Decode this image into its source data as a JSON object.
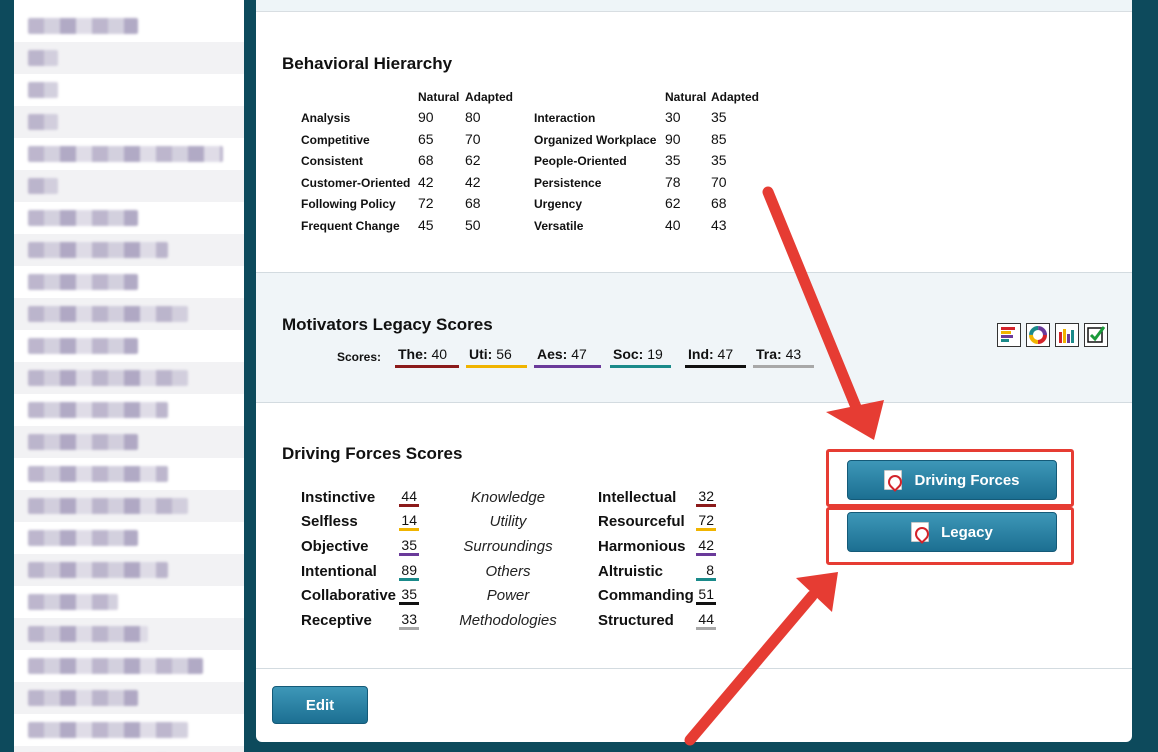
{
  "behavioral": {
    "title": "Behavioral Hierarchy",
    "col_natural": "Natural",
    "col_adapted": "Adapted",
    "left": [
      {
        "label": "Analysis",
        "natural": "90",
        "adapted": "80"
      },
      {
        "label": "Competitive",
        "natural": "65",
        "adapted": "70"
      },
      {
        "label": "Consistent",
        "natural": "68",
        "adapted": "62"
      },
      {
        "label": "Customer-Oriented",
        "natural": "42",
        "adapted": "42"
      },
      {
        "label": "Following Policy",
        "natural": "72",
        "adapted": "68"
      },
      {
        "label": "Frequent Change",
        "natural": "45",
        "adapted": "50"
      }
    ],
    "right": [
      {
        "label": "Interaction",
        "natural": "30",
        "adapted": "35"
      },
      {
        "label": "Organized Workplace",
        "natural": "90",
        "adapted": "85"
      },
      {
        "label": "People-Oriented",
        "natural": "35",
        "adapted": "35"
      },
      {
        "label": "Persistence",
        "natural": "78",
        "adapted": "70"
      },
      {
        "label": "Urgency",
        "natural": "62",
        "adapted": "68"
      },
      {
        "label": "Versatile",
        "natural": "40",
        "adapted": "43"
      }
    ]
  },
  "motivators": {
    "title": "Motivators Legacy Scores",
    "scores_label": "Scores:",
    "items": [
      {
        "abbr": "The:",
        "value": "40",
        "color": "#8b1a1a"
      },
      {
        "abbr": "Uti:",
        "value": "56",
        "color": "#f0b400"
      },
      {
        "abbr": "Aes:",
        "value": "47",
        "color": "#6a3a9a"
      },
      {
        "abbr": "Soc:",
        "value": "19",
        "color": "#1a8a8a"
      },
      {
        "abbr": "Ind:",
        "value": "47",
        "color": "#111111"
      },
      {
        "abbr": "Tra:",
        "value": "43",
        "color": "#a8a8a8"
      }
    ],
    "view_icons": [
      "bar-list-icon",
      "ring-chart-icon",
      "column-chart-icon",
      "checkbox-icon"
    ]
  },
  "driving": {
    "title": "Driving Forces Scores",
    "rows": [
      {
        "left": "Instinctive",
        "left_score": "44",
        "middle": "Knowledge",
        "right": "Intellectual",
        "right_score": "32",
        "color": "#8b1a1a"
      },
      {
        "left": "Selfless",
        "left_score": "14",
        "middle": "Utility",
        "right": "Resourceful",
        "right_score": "72",
        "color": "#f0b400"
      },
      {
        "left": "Objective",
        "left_score": "35",
        "middle": "Surroundings",
        "right": "Harmonious",
        "right_score": "42",
        "color": "#6a3a9a"
      },
      {
        "left": "Intentional",
        "left_score": "89",
        "middle": "Others",
        "right": "Altruistic",
        "right_score": "8",
        "color": "#1a8a8a"
      },
      {
        "left": "Collaborative",
        "left_score": "35",
        "middle": "Power",
        "right": "Commanding",
        "right_score": "51",
        "color": "#111111"
      },
      {
        "left": "Receptive",
        "left_score": "33",
        "middle": "Methodologies",
        "right": "Structured",
        "right_score": "44",
        "color": "#a8a8a8"
      }
    ]
  },
  "buttons": {
    "driving_forces": "Driving Forces",
    "legacy": "Legacy",
    "edit": "Edit"
  },
  "colors": {
    "accent": "#1c6f92",
    "highlight": "#e63c33",
    "frame": "#0d4a5c"
  }
}
